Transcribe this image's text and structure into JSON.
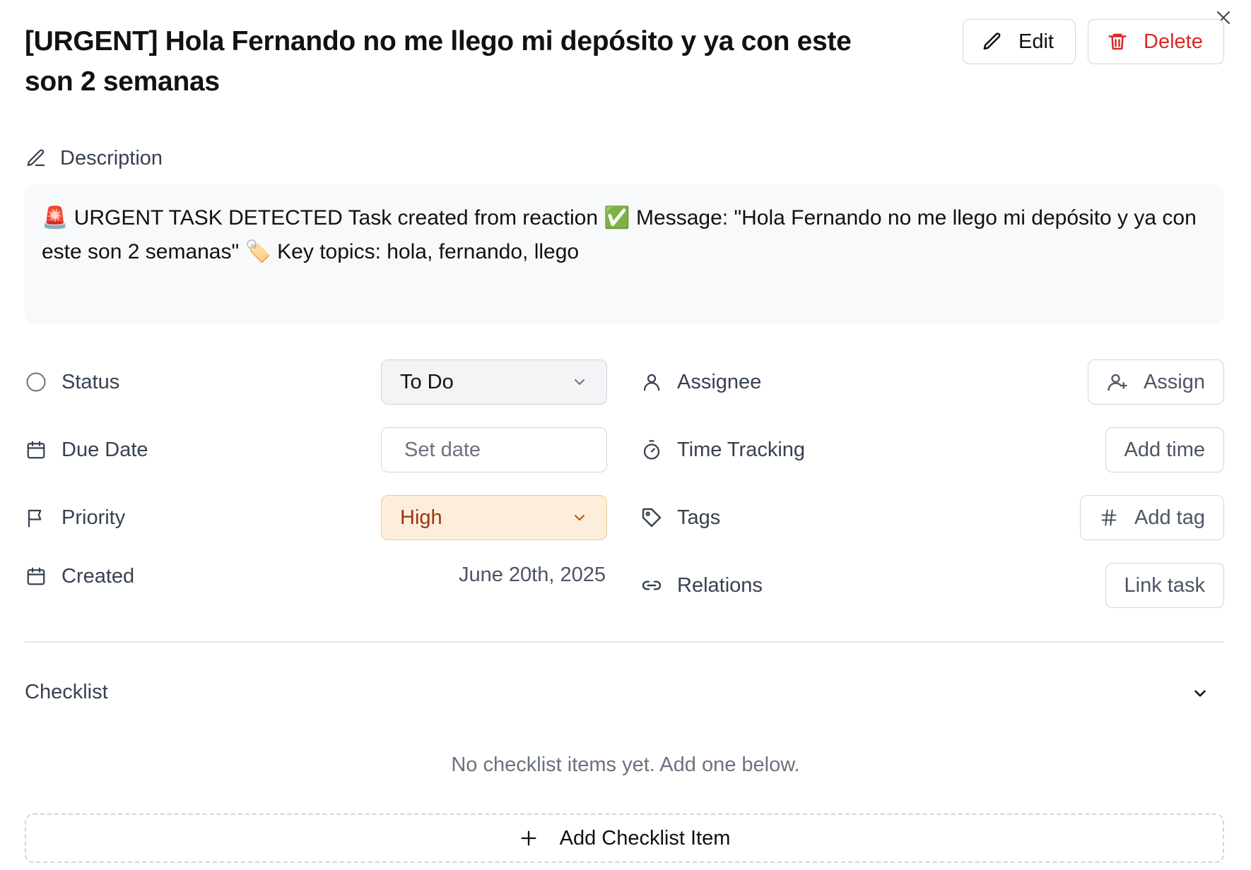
{
  "task": {
    "title": "[URGENT] Hola Fernando no me llego mi depósito y ya con este son 2 semanas"
  },
  "header": {
    "edit_label": "Edit",
    "delete_label": "Delete"
  },
  "description": {
    "label": "Description",
    "text": "🚨 URGENT TASK DETECTED Task created from reaction ✅ Message: \"Hola Fernando no me llego mi depósito y ya con este son 2 semanas\" 🏷️ Key topics: hola, fernando, llego"
  },
  "properties": {
    "status": {
      "label": "Status",
      "value": "To Do"
    },
    "due_date": {
      "label": "Due Date",
      "placeholder": "Set date"
    },
    "priority": {
      "label": "Priority",
      "value": "High"
    },
    "created": {
      "label": "Created",
      "value": "June 20th, 2025"
    },
    "assignee": {
      "label": "Assignee",
      "button": "Assign"
    },
    "time_tracking": {
      "label": "Time Tracking",
      "button": "Add time"
    },
    "tags": {
      "label": "Tags",
      "button": "Add tag"
    },
    "relations": {
      "label": "Relations",
      "button": "Link task"
    }
  },
  "checklist": {
    "title": "Checklist",
    "empty_message": "No checklist items yet. Add one below.",
    "add_label": "Add Checklist Item"
  },
  "colors": {
    "delete_red": "#dc2626",
    "priority_bg": "#fdeedb",
    "priority_text": "#9a3412",
    "description_bg": "#f8f9fb"
  },
  "icons": [
    "close-icon",
    "pencil-icon",
    "trash-icon",
    "circle-icon",
    "calendar-icon",
    "flag-icon",
    "user-icon",
    "user-plus-icon",
    "timer-icon",
    "tag-icon",
    "hash-icon",
    "link-icon",
    "chevron-down-icon",
    "plus-icon"
  ]
}
